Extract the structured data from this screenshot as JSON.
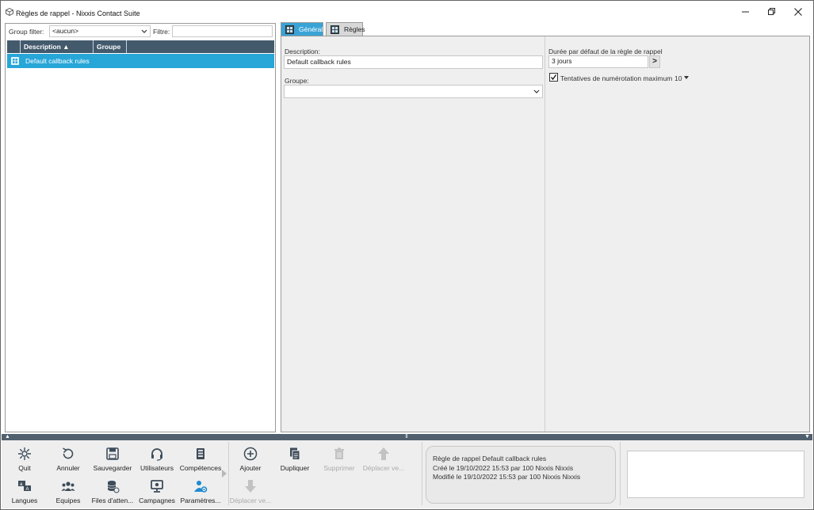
{
  "window": {
    "title": "Règles de rappel - Nixxis Contact Suite"
  },
  "left_pane": {
    "group_filter_label": "Group filter:",
    "group_filter_value": "<aucun>",
    "filter_label": "Filtre:",
    "filter_value": "",
    "columns": [
      "Description ▲",
      "Groupe"
    ],
    "rows": [
      {
        "description": "Default callback rules",
        "groupe": ""
      }
    ]
  },
  "tabs": [
    {
      "label": "Général",
      "active": true
    },
    {
      "label": "Règles",
      "active": false
    }
  ],
  "general": {
    "description_label": "Description:",
    "description_value": "Default callback rules",
    "groupe_label": "Groupe:",
    "groupe_value": "",
    "duree_label": "Durée par défaut de la règle de rappel",
    "duree_value": "3 jours",
    "duree_button": ">",
    "tentatives_label": "Tentatives de numérotation maximum",
    "tentatives_value": "10",
    "tentatives_checked": true
  },
  "toolbar": {
    "items": [
      {
        "label": "Quit",
        "icon": "quit-icon"
      },
      {
        "label": "Annuler",
        "icon": "undo-icon"
      },
      {
        "label": "Sauvegarder",
        "icon": "save-icon"
      },
      {
        "label": "Utilisateurs",
        "icon": "headset-icon"
      },
      {
        "label": "Compétences",
        "icon": "skills-icon"
      },
      {
        "label": "Langues",
        "icon": "languages-icon"
      },
      {
        "label": "Equipes",
        "icon": "teams-icon"
      },
      {
        "label": "Files d'atten...",
        "icon": "queues-icon"
      },
      {
        "label": "Campagnes",
        "icon": "campaigns-icon"
      },
      {
        "label": "Paramètres...",
        "icon": "settings-user-icon"
      }
    ],
    "actions": [
      {
        "label": "Ajouter",
        "icon": "add-icon",
        "enabled": true
      },
      {
        "label": "Dupliquer",
        "icon": "duplicate-icon",
        "enabled": true
      },
      {
        "label": "Supprimer",
        "icon": "trash-icon",
        "enabled": false
      },
      {
        "label": "Déplacer ve...",
        "icon": "arrow-up-icon",
        "enabled": false
      },
      {
        "label": "Déplacer ve...",
        "icon": "arrow-down-icon",
        "enabled": false
      }
    ]
  },
  "info": {
    "line1": "Règle de rappel Default callback rules",
    "line2": "Créé le 19/10/2022 15:53 par 100 Nixxis Nixxis",
    "line3": "Modifié le 19/10/2022 15:53 par 100 Nixxis Nixxis"
  },
  "colors": {
    "accent": "#27a6d8",
    "header": "#435a6d",
    "splitter": "#51606e"
  }
}
